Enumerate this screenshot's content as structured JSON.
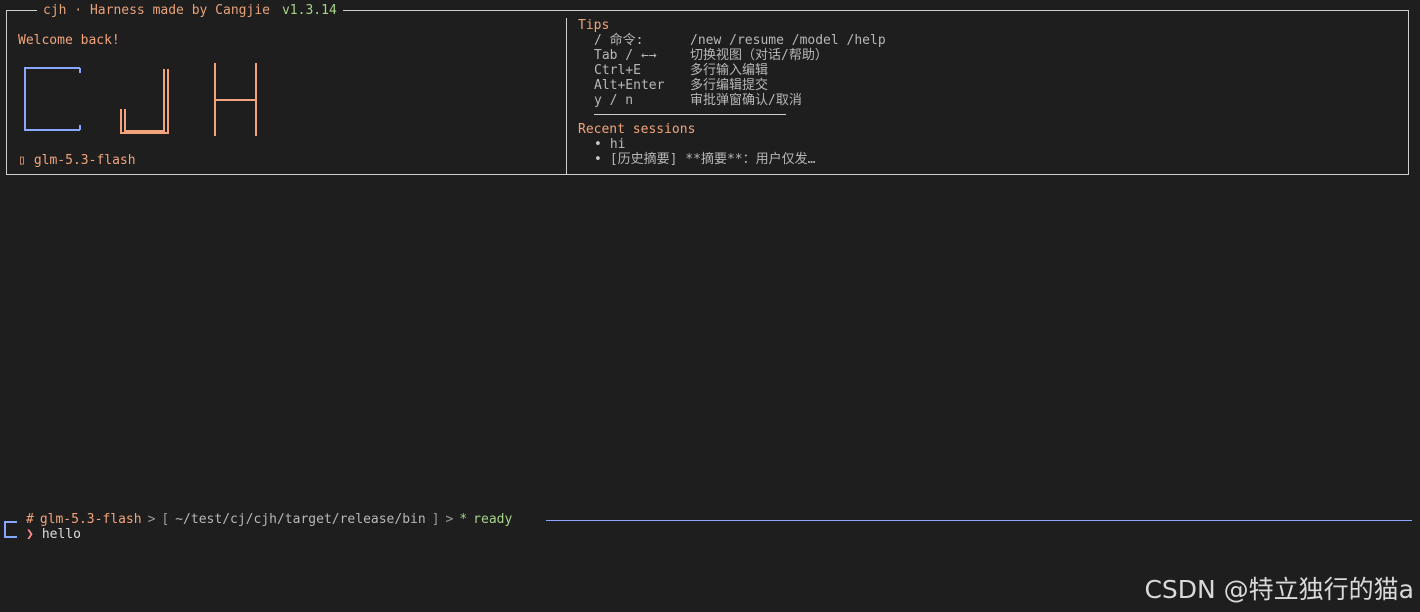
{
  "panel": {
    "title": "cjh · Harness made by Cangjie",
    "version": "v1.3.14"
  },
  "welcome": "Welcome back!",
  "logo_text": "CJH",
  "model_badge": "glm-5.3-flash",
  "tips": {
    "title": "Tips",
    "items": [
      {
        "key": "/ 命令:",
        "desc": "/new /resume /model /help"
      },
      {
        "key": "Tab / ←→",
        "desc": "切换视图（对话/帮助）"
      },
      {
        "key": "Ctrl+E",
        "desc": "多行输入编辑"
      },
      {
        "key": "Alt+Enter",
        "desc": "多行编辑提交"
      },
      {
        "key": "y / n",
        "desc": "审批弹窗确认/取消"
      }
    ]
  },
  "recent_sessions": {
    "title": "Recent sessions",
    "items": [
      "hi",
      "[历史摘要] **摘要**：用户仅发…"
    ]
  },
  "status": {
    "hash": "#",
    "model": "glm-5.3-flash",
    "sep1": ">",
    "path_open": "[",
    "path": "~/test/cj/cjh/target/release/bin",
    "path_close": "]",
    "sep2": ">",
    "star": "*",
    "state": "ready"
  },
  "input": {
    "caret": "❯",
    "value": "hello"
  },
  "watermark": "CSDN @特立独行的猫a",
  "colors": {
    "background": "#1e1e1e",
    "accent_orange": "#f1a47b",
    "accent_green": "#a6d38a",
    "accent_blue": "#8aa7ff",
    "text_gray": "#b7b7b7"
  },
  "icons": {
    "model_icon": "model-icon",
    "bullet_icon": "bullet-icon",
    "caret_icon": "prompt-caret-icon"
  }
}
